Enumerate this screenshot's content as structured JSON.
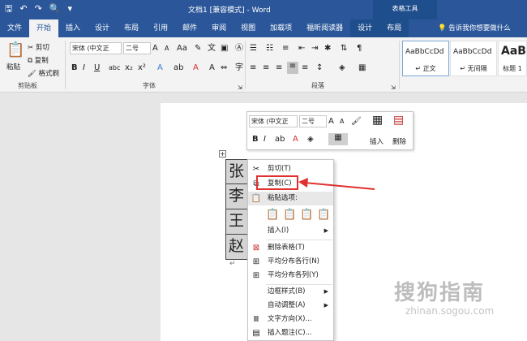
{
  "titlebar": {
    "doc_title": "文档1 [兼容模式] - Word",
    "table_tools": "表格工具"
  },
  "tabs": [
    "文件",
    "开始",
    "插入",
    "设计",
    "布局",
    "引用",
    "邮件",
    "审阅",
    "视图",
    "加载项",
    "福昕阅读器",
    "设计",
    "布局"
  ],
  "tell_me": "告诉我你想要做什么",
  "ribbon": {
    "clipboard": {
      "paste": "粘贴",
      "cut": "剪切",
      "copy": "复制",
      "format_painter": "格式刷",
      "label": "剪贴板"
    },
    "font": {
      "name": "宋体 (中文正",
      "size": "二号",
      "label": "字体"
    },
    "paragraph": {
      "label": "段落"
    },
    "styles": [
      {
        "sample": "AaBbCcDd",
        "name": "↵ 正文"
      },
      {
        "sample": "AaBbCcDd",
        "name": "↵ 无间隔"
      },
      {
        "sample": "AaBb",
        "name": "标题 1"
      }
    ]
  },
  "mini_toolbar": {
    "font": "宋体 (中文正",
    "size": "二号",
    "insert": "插入",
    "delete": "删除"
  },
  "table": {
    "cells": [
      "张",
      "李",
      "王",
      "赵"
    ]
  },
  "context_menu": {
    "cut": "剪切(T)",
    "copy": "复制(C)",
    "paste_options": "粘贴选项:",
    "insert": "插入(I)",
    "delete_table": "删除表格(T)",
    "distribute_rows": "平均分布各行(N)",
    "distribute_cols": "平均分布各列(Y)",
    "border_styles": "边框样式(B)",
    "autofit": "自动调整(A)",
    "text_direction": "文字方向(X)...",
    "insert_caption": "插入题注(C)..."
  },
  "watermark": {
    "line1": "搜狗指南",
    "line2": "zhinan.sogou.com"
  },
  "colors": {
    "brand": "#2b579a",
    "highlight": "#e03030"
  }
}
